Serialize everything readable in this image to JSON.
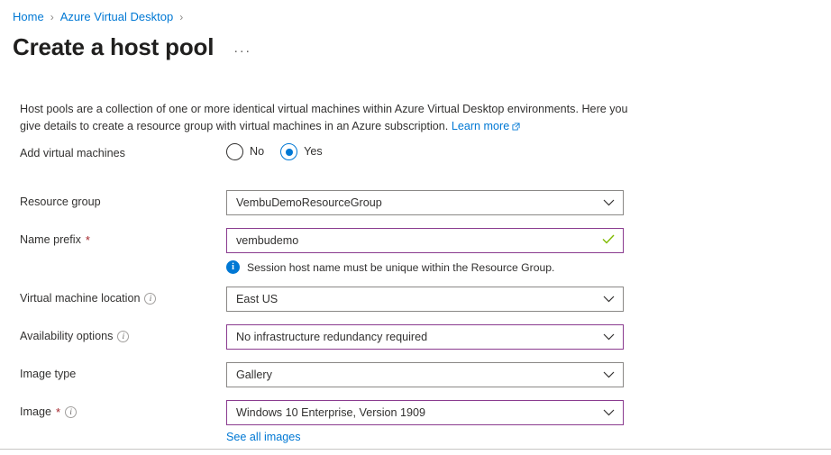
{
  "breadcrumb": {
    "items": [
      {
        "label": "Home"
      },
      {
        "label": "Azure Virtual Desktop"
      }
    ],
    "separator": "›"
  },
  "header": {
    "title": "Create a host pool",
    "more_label": "···"
  },
  "description": {
    "text": "Host pools are a collection of one or more identical virtual machines within Azure Virtual Desktop environments. Here you give details to create a resource group with virtual machines in an Azure subscription. ",
    "learn_more_label": "Learn more"
  },
  "form": {
    "add_virtual_machines": {
      "label": "Add virtual machines",
      "options": [
        {
          "label": "No",
          "selected": false
        },
        {
          "label": "Yes",
          "selected": true
        }
      ]
    },
    "resource_group": {
      "label": "Resource group",
      "value": "VembuDemoResourceGroup"
    },
    "name_prefix": {
      "label": "Name prefix",
      "required": "*",
      "value": "vembudemo",
      "info_message": "Session host name must be unique within the Resource Group."
    },
    "virtual_machine_location": {
      "label": "Virtual machine location",
      "value": "East US"
    },
    "availability_options": {
      "label": "Availability options",
      "value": "No infrastructure redundancy required"
    },
    "image_type": {
      "label": "Image type",
      "value": "Gallery"
    },
    "image": {
      "label": "Image",
      "required": "*",
      "value": "Windows 10 Enterprise, Version 1909",
      "see_all_label": "See all images"
    }
  },
  "colors": {
    "link": "#0078d4",
    "accent": "#0078d4",
    "modified_border": "#8a3b8f",
    "required_star": "#a4262c",
    "valid_check": "#7fba00",
    "default_border": "#8a8886"
  }
}
